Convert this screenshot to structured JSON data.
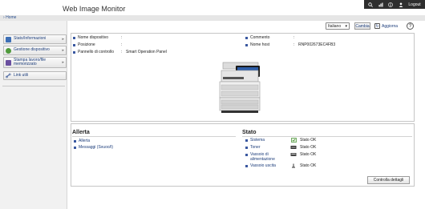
{
  "header": {
    "title": "Web Image Monitor",
    "logout": "Logout",
    "icons": [
      "search-icon",
      "status-icon",
      "info-icon",
      "user-icon"
    ]
  },
  "breadcrumb": {
    "home": "Home"
  },
  "sidebar": {
    "items": [
      {
        "label": "Stato/Informazioni",
        "icon": "status-info-icon",
        "color": "#3d6fb6"
      },
      {
        "label": "Gestione dispositivo",
        "icon": "device-management-icon",
        "color": "#4f9a3c"
      },
      {
        "label": "Stampa lavoro/file memorizzato",
        "icon": "stored-job-icon",
        "color": "#6a4fa0"
      },
      {
        "label": "Link utili",
        "icon": "useful-links-icon",
        "color": "#5a73a8"
      }
    ]
  },
  "toolbar": {
    "language": "Italiano",
    "change_label": "Cambia",
    "refresh_label": "Aggiorna",
    "help": "?"
  },
  "device": {
    "rows_left": [
      {
        "label": "Nome dispositivo",
        "sep": ":",
        "value": ""
      },
      {
        "label": "Posizione",
        "sep": ":",
        "value": ""
      },
      {
        "label": "Pannello di controllo",
        "sep": ":",
        "value": "Smart Operation Panel"
      }
    ],
    "rows_right": [
      {
        "label": "Commento",
        "sep": ":",
        "value": ""
      },
      {
        "label": "Nome host",
        "sep": ":",
        "value": "RNP002673EC4FB3"
      }
    ]
  },
  "alert": {
    "heading": "Allerta",
    "links": [
      "Allerta",
      "Messaggi (Svuoo/I)"
    ]
  },
  "status": {
    "heading": "Stato",
    "items": [
      {
        "label": "Sistema",
        "value": "Stato OK",
        "icon": "system-ok-icon"
      },
      {
        "label": "Toner",
        "value": "Stato OK",
        "icon": "toner-ok-icon"
      },
      {
        "label": "Vassoio di alimentazione",
        "value": "Stato OK",
        "icon": "input-tray-ok-icon"
      },
      {
        "label": "Vassoio uscita",
        "value": "Stato OK",
        "icon": "output-tray-ok-icon"
      }
    ],
    "details_button": "Controlla dettagli"
  }
}
